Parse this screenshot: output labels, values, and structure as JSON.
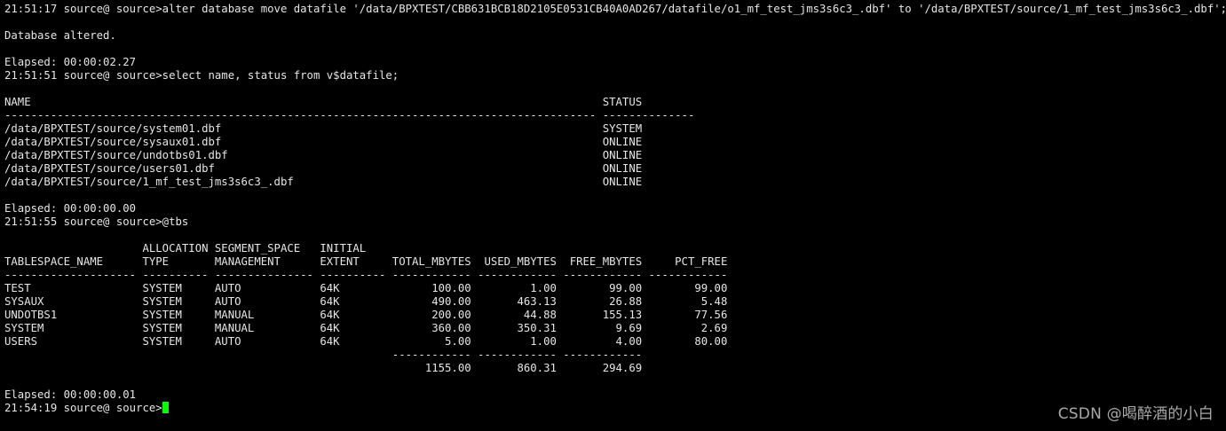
{
  "terminal": {
    "colors": {
      "background": "#000000",
      "text": "#e6e6e6",
      "cursor": "#00ff00",
      "watermark": "#a9a9a9"
    },
    "lines": [
      "21:51:17 source@ source>alter database move datafile '/data/BPXTEST/CBB631BCB18D2105E0531CB40A0AD267/datafile/o1_mf_test_jms3s6c3_.dbf' to '/data/BPXTEST/source/1_mf_test_jms3s6c3_.dbf';",
      "",
      "Database altered.",
      "",
      "Elapsed: 00:00:02.27",
      "21:51:51 source@ source>select name, status from v$datafile;",
      "",
      "NAME                                                                                       STATUS",
      "------------------------------------------------------------------------------------------ --------------",
      "/data/BPXTEST/source/system01.dbf                                                          SYSTEM",
      "/data/BPXTEST/source/sysaux01.dbf                                                          ONLINE",
      "/data/BPXTEST/source/undotbs01.dbf                                                         ONLINE",
      "/data/BPXTEST/source/users01.dbf                                                           ONLINE",
      "/data/BPXTEST/source/1_mf_test_jms3s6c3_.dbf                                               ONLINE",
      "",
      "Elapsed: 00:00:00.00",
      "21:51:55 source@ source>@tbs",
      "",
      "                     ALLOCATION SEGMENT_SPACE   INITIAL",
      "TABLESPACE_NAME      TYPE       MANAGEMENT      EXTENT     TOTAL_MBYTES  USED_MBYTES  FREE_MBYTES     PCT_FREE",
      "-------------------- ---------- --------------- ---------- ------------ ------------ ------------ ------------",
      "TEST                 SYSTEM     AUTO            64K              100.00         1.00        99.00        99.00",
      "SYSAUX               SYSTEM     AUTO            64K              490.00       463.13        26.88         5.48",
      "UNDOTBS1             SYSTEM     MANUAL          64K              200.00        44.88       155.13        77.56",
      "SYSTEM               SYSTEM     MANUAL          64K              360.00       350.31         9.69         2.69",
      "USERS                SYSTEM     AUTO            64K                5.00         1.00         4.00        80.00",
      "                                                           ------------ ------------ ------------",
      "                                                                1155.00       860.31       294.69",
      "",
      "Elapsed: 00:00:00.01"
    ],
    "prompt": "21:54:19 source@ source>"
  },
  "watermark": {
    "text": "CSDN @喝醉酒的小白"
  }
}
